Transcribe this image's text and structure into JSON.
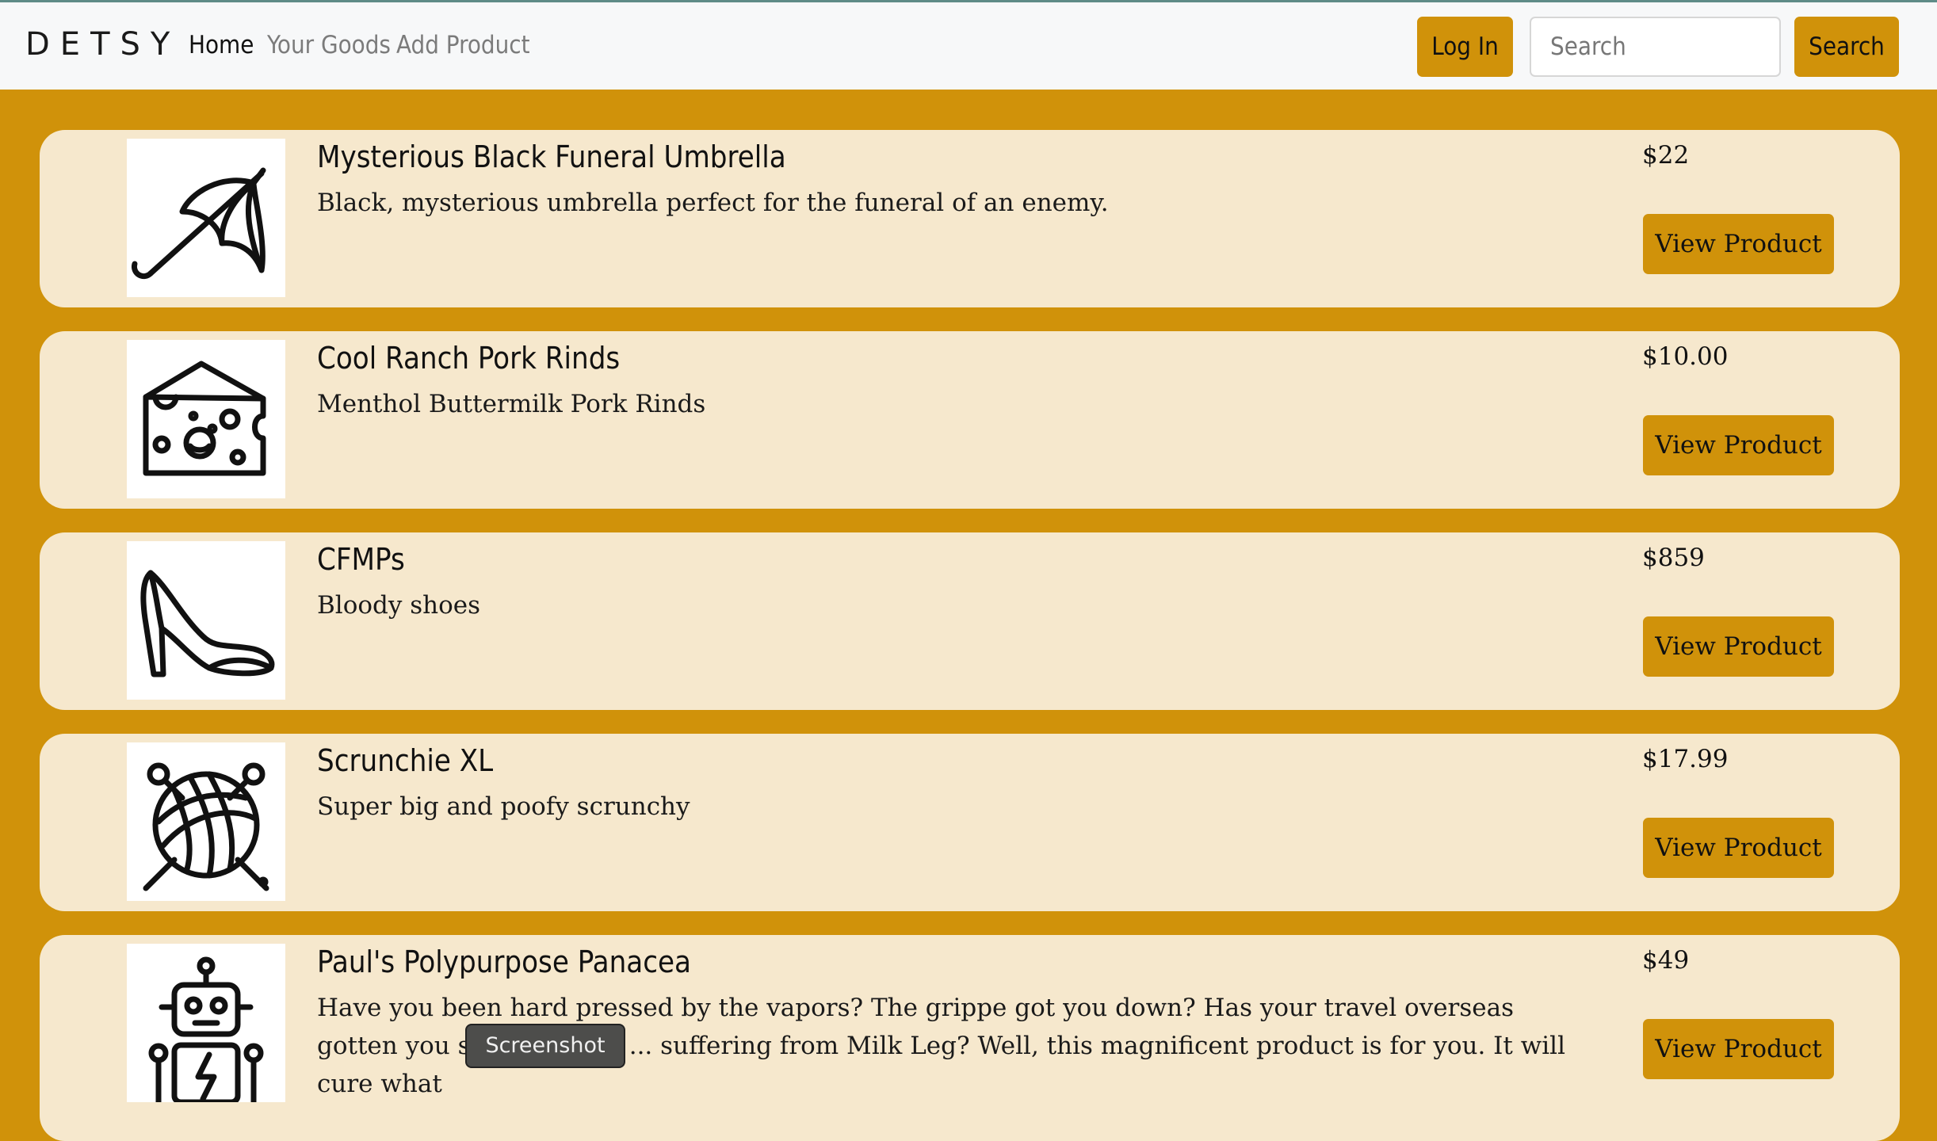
{
  "brand": "DETSY",
  "nav": {
    "home": "Home",
    "your_goods": "Your Goods",
    "add_product": "Add Product",
    "login": "Log In",
    "search_placeholder": "Search",
    "search_button": "Search"
  },
  "products": [
    {
      "title": "Mysterious Black Funeral Umbrella",
      "description": "Black, mysterious umbrella perfect for the funeral of an enemy.",
      "price": "$22",
      "button": "View Product",
      "icon": "umbrella-icon"
    },
    {
      "title": "Cool Ranch Pork Rinds",
      "description": "Menthol Buttermilk Pork Rinds",
      "price": "$10.00",
      "button": "View Product",
      "icon": "cheese-icon"
    },
    {
      "title": "CFMPs",
      "description": "Bloody shoes",
      "price": "$859",
      "button": "View Product",
      "icon": "high-heel-icon"
    },
    {
      "title": "Scrunchie XL",
      "description": "Super big and poofy scrunchy",
      "price": "$17.99",
      "button": "View Product",
      "icon": "yarn-ball-icon"
    },
    {
      "title": "Paul's Polypurpose Panacea",
      "description": "Have you been hard pressed by the vapors? The grippe got you down? Has your travel overseas gotten you stricken with ... suffering from Milk Leg? Well, this magnificent product is for you. It will cure what",
      "price": "$49",
      "button": "View Product",
      "icon": "robot-icon"
    }
  ],
  "tooltip": "Screenshot",
  "colors": {
    "accent": "#d0920a",
    "card": "#f6e8cd",
    "navbar": "#f7f8f9"
  }
}
